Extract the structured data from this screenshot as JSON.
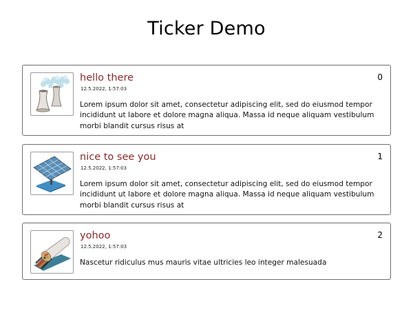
{
  "page": {
    "title": "Ticker Demo"
  },
  "tickers": [
    {
      "title": "hello there",
      "timestamp": "12.5.2022, 1:57:03",
      "body": "Lorem ipsum dolor sit amet, consectetur adipiscing elit, sed do eiusmod tempor incididunt ut labore et dolore magna aliqua. Massa id neque aliquam vestibulum morbi blandit cursus risus at",
      "count": "0",
      "icon": "cooling-tower-icon"
    },
    {
      "title": "nice to see you",
      "timestamp": "12.5.2022, 1:57:03",
      "body": "Lorem ipsum dolor sit amet, consectetur adipiscing elit, sed do eiusmod tempor incididunt ut labore et dolore magna aliqua. Massa id neque aliquam vestibulum morbi blandit cursus risus at",
      "count": "1",
      "icon": "solar-panel-icon"
    },
    {
      "title": "yohoo",
      "timestamp": "12.5.2022, 1:57:03",
      "body": "Nascetur ridiculus mus mauris vitae ultricies leo integer malesuada",
      "count": "2",
      "icon": "cable-icon"
    }
  ],
  "colors": {
    "title_accent": "#8b2a2a",
    "card_border": "#6f6f6f"
  }
}
